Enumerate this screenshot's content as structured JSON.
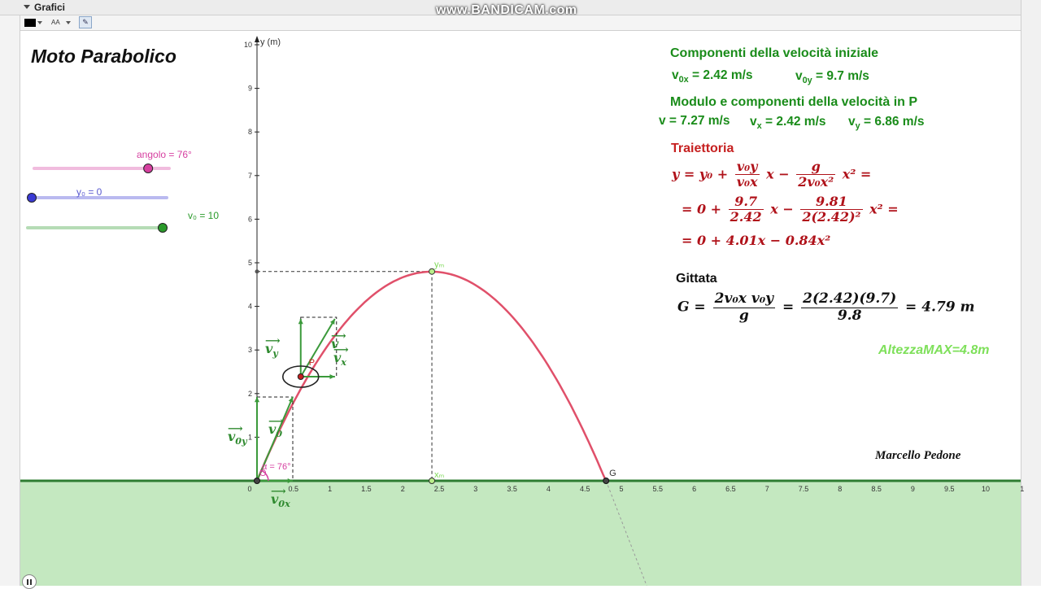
{
  "window": {
    "panel_title": "Grafici",
    "watermark": "www.BANDICAM.com"
  },
  "toolbar": {
    "font_size_label": "AA"
  },
  "title": "Moto Parabolico",
  "sliders": {
    "angolo": {
      "label": "angolo = 76°",
      "value": 76,
      "min": 0,
      "max": 90,
      "color": "#d63fa0"
    },
    "y0": {
      "label": "y₀ = 0",
      "value": 0,
      "min": 0,
      "max": 10,
      "color": "#3a3ad4"
    },
    "v0": {
      "label": "v₀ = 10",
      "value": 10,
      "min": 0,
      "max": 10,
      "color": "#2a9a2a"
    }
  },
  "panel": {
    "components_heading": "Componenti della velocità iniziale",
    "v0x_value": "= 2.42 m/s",
    "v0y_value": "= 9.7 m/s",
    "module_heading": "Modulo e componenti della velocità in P",
    "v_value": "v = 7.27 m/s",
    "vx_value": "= 2.42 m/s",
    "vy_value": "= 6.86 m/s",
    "trajectory_heading": "Traiettoria",
    "range_heading": "Gittata",
    "max_height": "AltezzaMAX=4.8m",
    "author": "Marcello Pedone"
  },
  "formulas": {
    "eq1_lhs": "y = y₀ +",
    "eq1_f1_num": "v₀y",
    "eq1_f1_den": "v₀x",
    "eq1_mid": "x −",
    "eq1_f2_num": "g",
    "eq1_f2_den": "2v₀x²",
    "eq1_end": "x² =",
    "eq2_lhs": "= 0 +",
    "eq2_f1_num": "9.7",
    "eq2_f1_den": "2.42",
    "eq2_mid": "x −",
    "eq2_f2_num": "9.81",
    "eq2_f2_den": "2(2.42)²",
    "eq2_end": "x² =",
    "eq3": "= 0 + 4.01x − 0.84x²",
    "range_lhs": "G =",
    "range_f1_num": "2v₀x v₀y",
    "range_f1_den": "g",
    "range_eq": "=",
    "range_f2_num": "2(2.42)(9.7)",
    "range_f2_den": "9.8",
    "range_result": "= 4.79 m"
  },
  "graph_labels": {
    "y_axis": "y (m)",
    "point_p": "P",
    "point_g": "G",
    "point_ym": "yₘ",
    "point_xm": "xₘ",
    "angle_label": "α = 76°",
    "origin": "O",
    "vec_v": "v",
    "vec_vy": "v",
    "vec_vy_sub": "y",
    "vec_vx": "v",
    "vec_vx_sub": "x",
    "vec_v0": "v",
    "vec_v0_sub": "0",
    "vec_v0y": "v",
    "vec_v0y_sub": "0y",
    "vec_v0x": "v",
    "vec_v0x_sub": "0x",
    "arrow_glyph": "⟶"
  },
  "axes": {
    "x_ticks": [
      "0",
      "0.5",
      "1",
      "1.5",
      "2",
      "2.5",
      "3",
      "3.5",
      "4",
      "4.5",
      "5",
      "5.5",
      "6",
      "6.5",
      "7",
      "7.5",
      "8",
      "8.5",
      "9",
      "9.5",
      "10",
      "1"
    ],
    "y_ticks": [
      "1",
      "2",
      "3",
      "4",
      "5",
      "6",
      "7",
      "8",
      "9",
      "10"
    ]
  },
  "physics": {
    "v0x": 2.42,
    "v0y": 9.7,
    "g": 9.81,
    "y0": 0,
    "range": 4.79,
    "max_height": 4.8,
    "xm": 2.4,
    "p_x": 0.6,
    "p_vx": 2.42,
    "p_vy": 6.86
  },
  "colors": {
    "trajectory": "#e0506a",
    "ground": "#c4e8c0",
    "ground_line": "#2e7d32",
    "vector": "#3b9a3b",
    "accent_green": "#1a8c1a",
    "accent_red": "#c62020"
  }
}
